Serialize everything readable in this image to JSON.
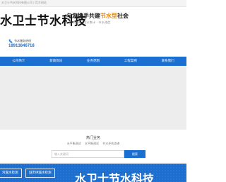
{
  "topbar": {
    "text": "水卫士节水科技有限公司 | 官方网站"
  },
  "header": {
    "logo": "水卫士节水科技",
    "slogan_prefix": "与您携手共建",
    "slogan_highlight": "节水型",
    "slogan_suffix": "社会",
    "subslogan": "节水检测 · 用水审计 · 节水改造",
    "hotline_label": "节水服务热线",
    "hotline_number": "18913846718"
  },
  "nav": {
    "items": [
      {
        "label": "公司简介"
      },
      {
        "label": "新闻资讯"
      },
      {
        "label": "业务范围"
      },
      {
        "label": "工程案例"
      },
      {
        "label": "联系我们"
      }
    ]
  },
  "search": {
    "title": "热门业务",
    "items": [
      "水平衡测试",
      "水平衡测试",
      "节水评估咨询"
    ],
    "placeholder": "输入关键词",
    "button": "搜索"
  },
  "bottom": {
    "tag1": "河漏水检测",
    "tag2": "城市供漏水检测",
    "logo": "水卫士节水科技"
  },
  "colors": {
    "brand": "#1a6fd1",
    "accent": "#e8890a"
  }
}
